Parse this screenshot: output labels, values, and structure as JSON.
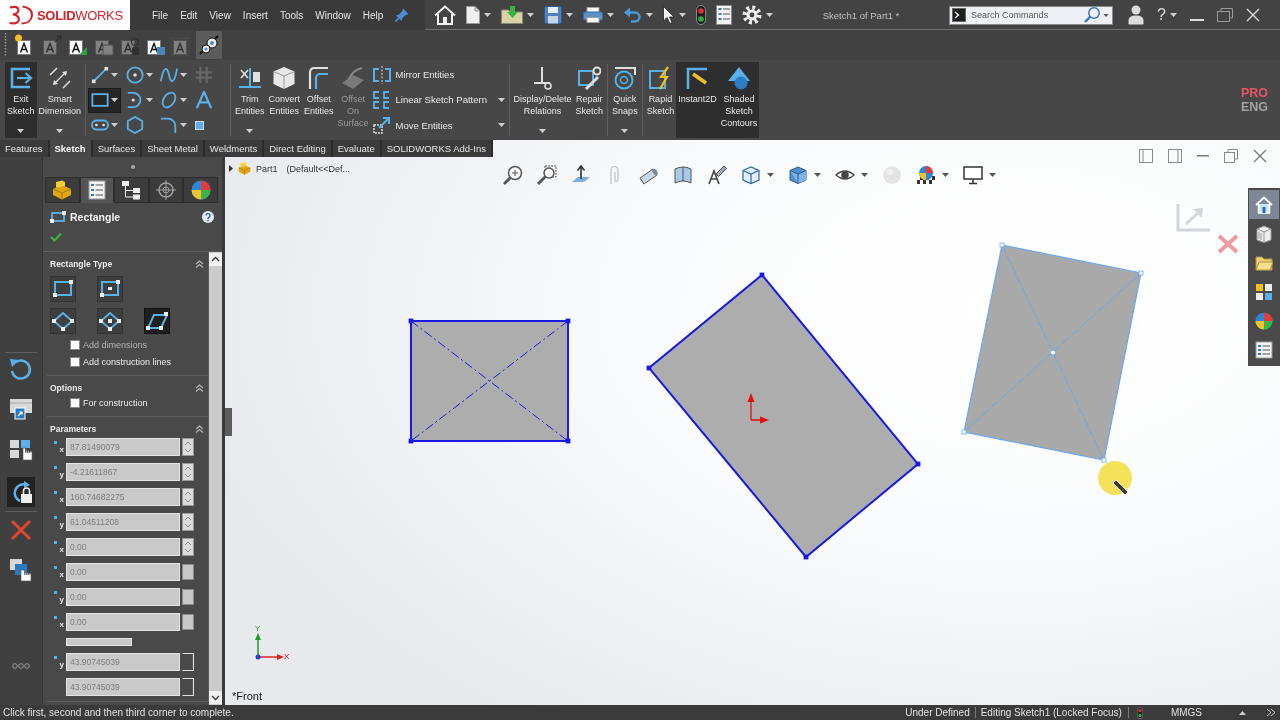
{
  "app": {
    "logo": "**SOLID**WORKS",
    "menu": [
      "File",
      "Edit",
      "View",
      "Insert",
      "Tools",
      "Window",
      "Help"
    ],
    "title": "Sketch1 of Part1 *",
    "search": {
      "placeholder": "Search Commands"
    },
    "help": "?"
  },
  "format_toolbar": [
    {
      "disabled": false,
      "on": false
    },
    {
      "disabled": true,
      "on": false
    },
    {
      "disabled": false,
      "on": false
    },
    {
      "disabled": true,
      "on": false
    },
    {
      "disabled": true,
      "on": false
    },
    {
      "disabled": false,
      "on": false
    },
    {
      "disabled": true,
      "on": false
    },
    {
      "disabled": false,
      "on": true
    }
  ],
  "ribbon": {
    "items": [
      {
        "kind": "large",
        "label": "Exit Sketch",
        "on": true,
        "caret": true,
        "disabled": false
      },
      {
        "kind": "large",
        "label": "Smart Dimension",
        "on": false,
        "caret": true,
        "disabled": false
      },
      {
        "kind": "grid",
        "tools": [
          {
            "selected": false,
            "caret": true,
            "disabled": false
          },
          {
            "selected": false,
            "caret": true,
            "disabled": false
          },
          {
            "selected": false,
            "caret": true,
            "disabled": false
          },
          {
            "selected": false,
            "caret": false,
            "disabled": true
          },
          {
            "selected": true,
            "caret": true,
            "disabled": false
          },
          {
            "selected": false,
            "caret": true,
            "disabled": false
          },
          {
            "selected": false,
            "caret": true,
            "disabled": false
          },
          {
            "selected": false,
            "caret": false,
            "disabled": false
          },
          {
            "selected": false,
            "caret": true,
            "disabled": false
          },
          {
            "selected": false,
            "caret": false,
            "disabled": false
          },
          {
            "selected": false,
            "caret": true,
            "disabled": false
          },
          {
            "selected": false,
            "caret": false,
            "disabled": false
          }
        ]
      },
      {
        "kind": "large",
        "label": "Trim Entities",
        "on": false,
        "caret": true,
        "disabled": false
      },
      {
        "kind": "large",
        "label": "Convert Entities",
        "on": false,
        "caret": false,
        "disabled": false
      },
      {
        "kind": "large",
        "label": "Offset Entities",
        "on": false,
        "caret": false,
        "disabled": false
      },
      {
        "kind": "large",
        "label": "Offset On Surface",
        "on": false,
        "caret": false,
        "disabled": true
      },
      {
        "kind": "stack",
        "entries": [
          {
            "label": "Mirror Entities",
            "caret": false
          },
          {
            "label": "Linear Sketch Pattern",
            "caret": true
          },
          {
            "label": "Move Entities",
            "caret": true
          }
        ]
      },
      {
        "kind": "large",
        "label": "Display/Delete Relations",
        "on": false,
        "caret": true,
        "disabled": false
      },
      {
        "kind": "large",
        "label": "Repair Sketch",
        "on": false,
        "caret": false,
        "disabled": false
      },
      {
        "kind": "large",
        "label": "Quick Snaps",
        "on": false,
        "caret": true,
        "disabled": false
      },
      {
        "kind": "large",
        "label": "Rapid Sketch",
        "on": false,
        "caret": false,
        "disabled": false
      },
      {
        "kind": "large",
        "label": "Instant2D",
        "on": true,
        "caret": false,
        "disabled": false
      },
      {
        "kind": "large",
        "label": "Shaded Sketch Contours",
        "on": true,
        "caret": false,
        "disabled": false
      }
    ],
    "badge": [
      "PRO",
      "ENG"
    ]
  },
  "tabs": [
    {
      "label": "Features",
      "selected": false
    },
    {
      "label": "Sketch",
      "selected": true
    },
    {
      "label": "Surfaces",
      "selected": false
    },
    {
      "label": "Sheet Metal",
      "selected": false
    },
    {
      "label": "Weldments",
      "selected": false
    },
    {
      "label": "Direct Editing",
      "selected": false
    },
    {
      "label": "Evaluate",
      "selected": false
    },
    {
      "label": "SOLIDWORKS Add-Ins",
      "selected": false
    }
  ],
  "shortcut_bar": [
    {
      "on": false
    },
    {
      "on": false
    },
    {
      "on": false
    },
    {
      "on": true
    },
    {
      "on": false
    },
    {
      "on": false
    }
  ],
  "property_manager": {
    "tabs": [
      {
        "selected": false
      },
      {
        "selected": true
      },
      {
        "selected": false
      },
      {
        "selected": false
      },
      {
        "selected": false
      }
    ],
    "title": "Rectangle",
    "groups": [
      {
        "kind": "rectangle_type",
        "title": "Rectangle Type",
        "expanded": true,
        "types": [
          {
            "selected": false
          },
          {
            "selected": false
          },
          {
            "selected": false
          },
          {
            "selected": false
          },
          {
            "selected": true
          }
        ],
        "checkboxes": [
          {
            "label": "Add dimensions",
            "checked": false,
            "disabled": true
          },
          {
            "label": "Add construction lines",
            "checked": false,
            "disabled": false
          }
        ]
      },
      {
        "kind": "options",
        "title": "Options",
        "expanded": true,
        "checkboxes": [
          {
            "label": "For construction",
            "checked": false,
            "disabled": false
          }
        ]
      },
      {
        "kind": "parameters",
        "title": "Parameters",
        "expanded": true,
        "fields": [
          {
            "kind": "spinner",
            "axis": "x",
            "value": "87.81490079"
          },
          {
            "kind": "spinner",
            "axis": "y",
            "value": "-4.21611867"
          },
          {
            "kind": "spinner",
            "axis": "x",
            "value": "160.74682275"
          },
          {
            "kind": "spinner",
            "axis": "y",
            "value": "61.04511208"
          },
          {
            "kind": "spinner",
            "axis": "x",
            "value": "0.00"
          },
          {
            "kind": "button",
            "axis": "x",
            "value": "0.00"
          },
          {
            "kind": "button",
            "axis": "y",
            "value": "0.00"
          },
          {
            "kind": "button",
            "axis": "x",
            "value": "0.00"
          },
          {
            "kind": "cut"
          },
          {
            "kind": "bracket",
            "axis": "y",
            "value": "43.90745039"
          },
          {
            "kind": "bracket",
            "value": "43.90745039"
          }
        ]
      }
    ]
  },
  "graphics": {
    "tree": {
      "name": "Part1",
      "config": "(Default<<Def...",
      "expanded": false
    },
    "view_toolbar": [
      {
        "caret": false,
        "disabled": false
      },
      {
        "caret": false,
        "disabled": false
      },
      {
        "caret": false,
        "disabled": false
      },
      {
        "caret": false,
        "disabled": true
      },
      {
        "caret": false,
        "disabled": false
      },
      {
        "caret": false,
        "disabled": false
      },
      {
        "caret": false,
        "disabled": false
      },
      {
        "caret": true,
        "disabled": false
      },
      {
        "caret": true,
        "disabled": false
      },
      {
        "caret": true,
        "disabled": false
      },
      {
        "caret": false,
        "disabled": true
      },
      {
        "caret": true,
        "disabled": false
      },
      {
        "caret": true,
        "disabled": false
      }
    ],
    "task_pane": [
      {
        "selected": true
      },
      {
        "selected": false
      },
      {
        "selected": false
      },
      {
        "selected": false
      },
      {
        "selected": false
      },
      {
        "selected": false
      }
    ],
    "sketch": [
      {
        "kind": "center_rectangle",
        "construction_lines": true,
        "preview": false
      },
      {
        "kind": "three_point_corner",
        "construction_lines": false,
        "preview": false
      },
      {
        "kind": "three_point_center",
        "construction_lines": true,
        "preview": true
      }
    ],
    "triad": {
      "x": "X",
      "y": "Y"
    },
    "view_label": "*Front"
  },
  "status_bar": {
    "prompt": "Click first, second and then third corner to complete.",
    "state": "Under Defined",
    "mode": "Editing Sketch1 (Locked Focus)",
    "units": "MMGS"
  }
}
